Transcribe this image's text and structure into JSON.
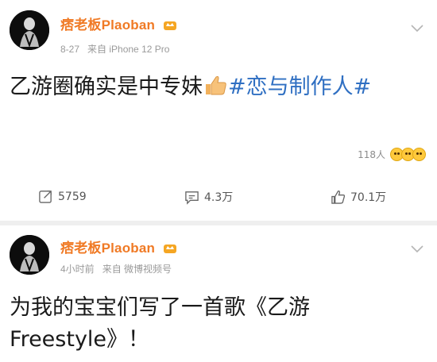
{
  "posts": [
    {
      "username": "痞老板Plaoban",
      "time": "8-27",
      "source": "来自 iPhone 12 Pro",
      "text_before": "乙游圈确实是中专妹",
      "hashtag": "#恋与制作人#",
      "reactions_count": "118人",
      "repost_count": "5759",
      "comment_count": "4.3万",
      "like_count": "70.1万",
      "icons": [
        "avatar",
        "crown-badge-icon",
        "chevron-down-icon",
        "thumbs-up-emoji",
        "repost-icon",
        "comment-icon",
        "like-icon"
      ]
    },
    {
      "username": "痞老板Plaoban",
      "time": "4小时前",
      "source": "来自 微博视频号",
      "text": "为我的宝宝们写了一首歌《乙游 Freestyle》！"
    }
  ],
  "colors": {
    "username": "#f07a25",
    "hashtag": "#2f6fc2",
    "meta": "#9a9a9a",
    "divider": "#efefef"
  }
}
